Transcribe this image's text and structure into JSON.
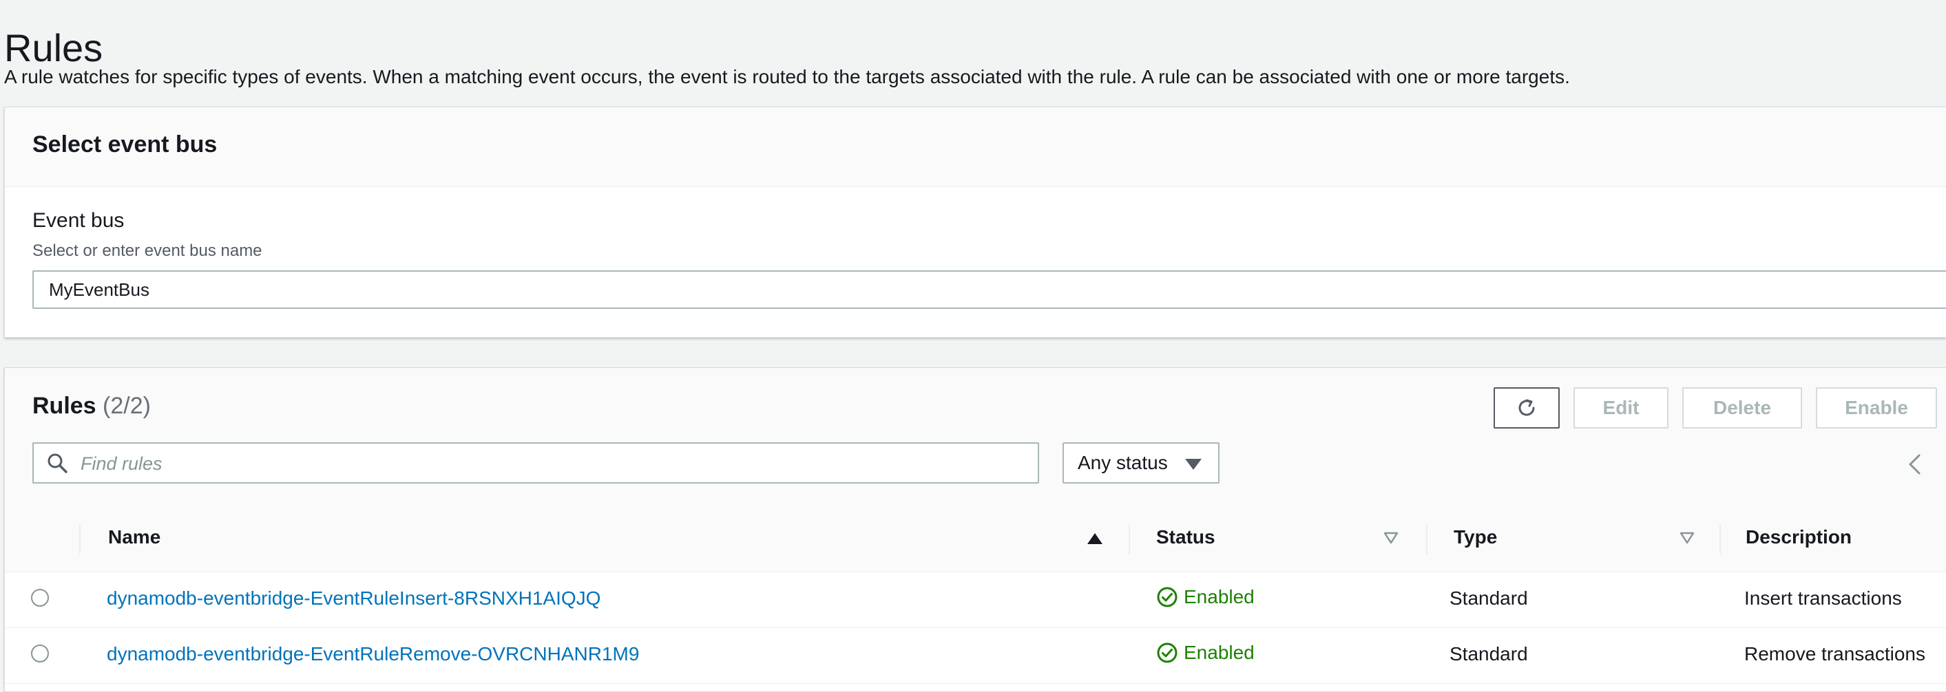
{
  "page": {
    "title": "Rules",
    "description": "A rule watches for specific types of events. When a matching event occurs, the event is routed to the targets associated with the rule. A rule can be associated with one or more targets."
  },
  "event_bus_panel": {
    "title": "Select event bus",
    "field_label": "Event bus",
    "field_description": "Select or enter event bus name",
    "value": "MyEventBus"
  },
  "rules_panel": {
    "title": "Rules",
    "count": "(2/2)",
    "buttons": {
      "refresh_icon": "refresh-icon",
      "edit": "Edit",
      "delete": "Delete",
      "enable": "Enable"
    },
    "search": {
      "placeholder": "Find rules",
      "value": ""
    },
    "status_filter": "Any status",
    "columns": [
      "Name",
      "Status",
      "Type",
      "Description"
    ],
    "rows": [
      {
        "name": "dynamodb-eventbridge-EventRuleInsert-8RSNXH1AIQJQ",
        "status": "Enabled",
        "type": "Standard",
        "description": "Insert transactions"
      },
      {
        "name": "dynamodb-eventbridge-EventRuleRemove-OVRCNHANR1M9",
        "status": "Enabled",
        "type": "Standard",
        "description": "Remove transactions"
      }
    ]
  },
  "colors": {
    "link": "#0073bb",
    "success": "#1d8102",
    "text": "#16191f",
    "disabled": "#aab7b8"
  }
}
